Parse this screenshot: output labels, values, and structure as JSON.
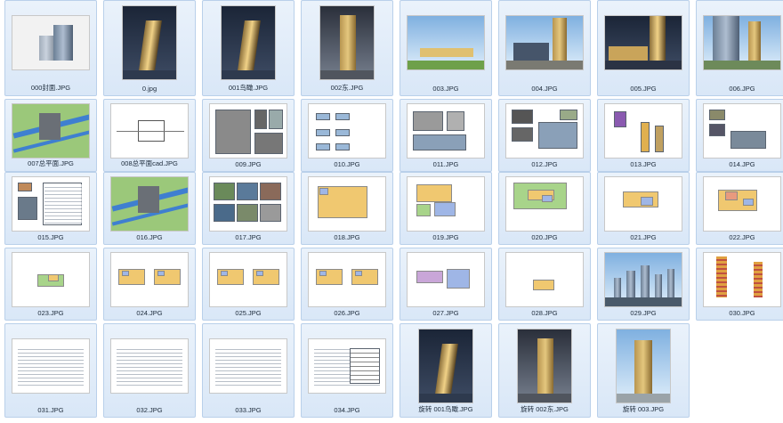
{
  "files": [
    {
      "label": "000封面.JPG",
      "kind": "cover"
    },
    {
      "label": "0.jpg",
      "kind": "aerial-night"
    },
    {
      "label": "001鸟瞰.JPG",
      "kind": "aerial-night"
    },
    {
      "label": "002东.JPG",
      "kind": "tower-dusk"
    },
    {
      "label": "003.JPG",
      "kind": "sky-low"
    },
    {
      "label": "004.JPG",
      "kind": "street-tower"
    },
    {
      "label": "005.JPG",
      "kind": "night-street"
    },
    {
      "label": "006.JPG",
      "kind": "street-glass"
    },
    {
      "label": "007总平面.JPG",
      "kind": "site-plan"
    },
    {
      "label": "008总平面cad.JPG",
      "kind": "cad"
    },
    {
      "label": "009.JPG",
      "kind": "doc-photos"
    },
    {
      "label": "010.JPG",
      "kind": "doc-diagrams"
    },
    {
      "label": "011.JPG",
      "kind": "doc-blocks"
    },
    {
      "label": "012.JPG",
      "kind": "doc-photos2"
    },
    {
      "label": "013.JPG",
      "kind": "doc-axo"
    },
    {
      "label": "014.JPG",
      "kind": "doc-photos3"
    },
    {
      "label": "015.JPG",
      "kind": "doc-text"
    },
    {
      "label": "016.JPG",
      "kind": "site-plan"
    },
    {
      "label": "017.JPG",
      "kind": "doc-photos4"
    },
    {
      "label": "018.JPG",
      "kind": "plan-big"
    },
    {
      "label": "019.JPG",
      "kind": "plan-color"
    },
    {
      "label": "020.JPG",
      "kind": "plan-green"
    },
    {
      "label": "021.JPG",
      "kind": "plan-small"
    },
    {
      "label": "022.JPG",
      "kind": "plan-red"
    },
    {
      "label": "023.JPG",
      "kind": "plan-line"
    },
    {
      "label": "024.JPG",
      "kind": "plan-pair"
    },
    {
      "label": "025.JPG",
      "kind": "plan-pair"
    },
    {
      "label": "026.JPG",
      "kind": "plan-pair"
    },
    {
      "label": "027.JPG",
      "kind": "plan-purple"
    },
    {
      "label": "028.JPG",
      "kind": "plan-empty"
    },
    {
      "label": "029.JPG",
      "kind": "elevation-sky"
    },
    {
      "label": "030.JPG",
      "kind": "section"
    },
    {
      "label": "031.JPG",
      "kind": "text"
    },
    {
      "label": "032.JPG",
      "kind": "text"
    },
    {
      "label": "033.JPG",
      "kind": "text"
    },
    {
      "label": "034.JPG",
      "kind": "text-table"
    },
    {
      "label": "旋转 001鸟瞰.JPG",
      "kind": "aerial-night-port"
    },
    {
      "label": "旋转 002东.JPG",
      "kind": "tower-dusk-port"
    },
    {
      "label": "旋转 003.JPG",
      "kind": "tower-sky-port"
    }
  ],
  "colors": {
    "tile_bg_top": "#eaf2fb",
    "tile_bg_bottom": "#d9e7f7",
    "tile_border": "#b9d0ea",
    "caption": "#1c2a3a"
  }
}
